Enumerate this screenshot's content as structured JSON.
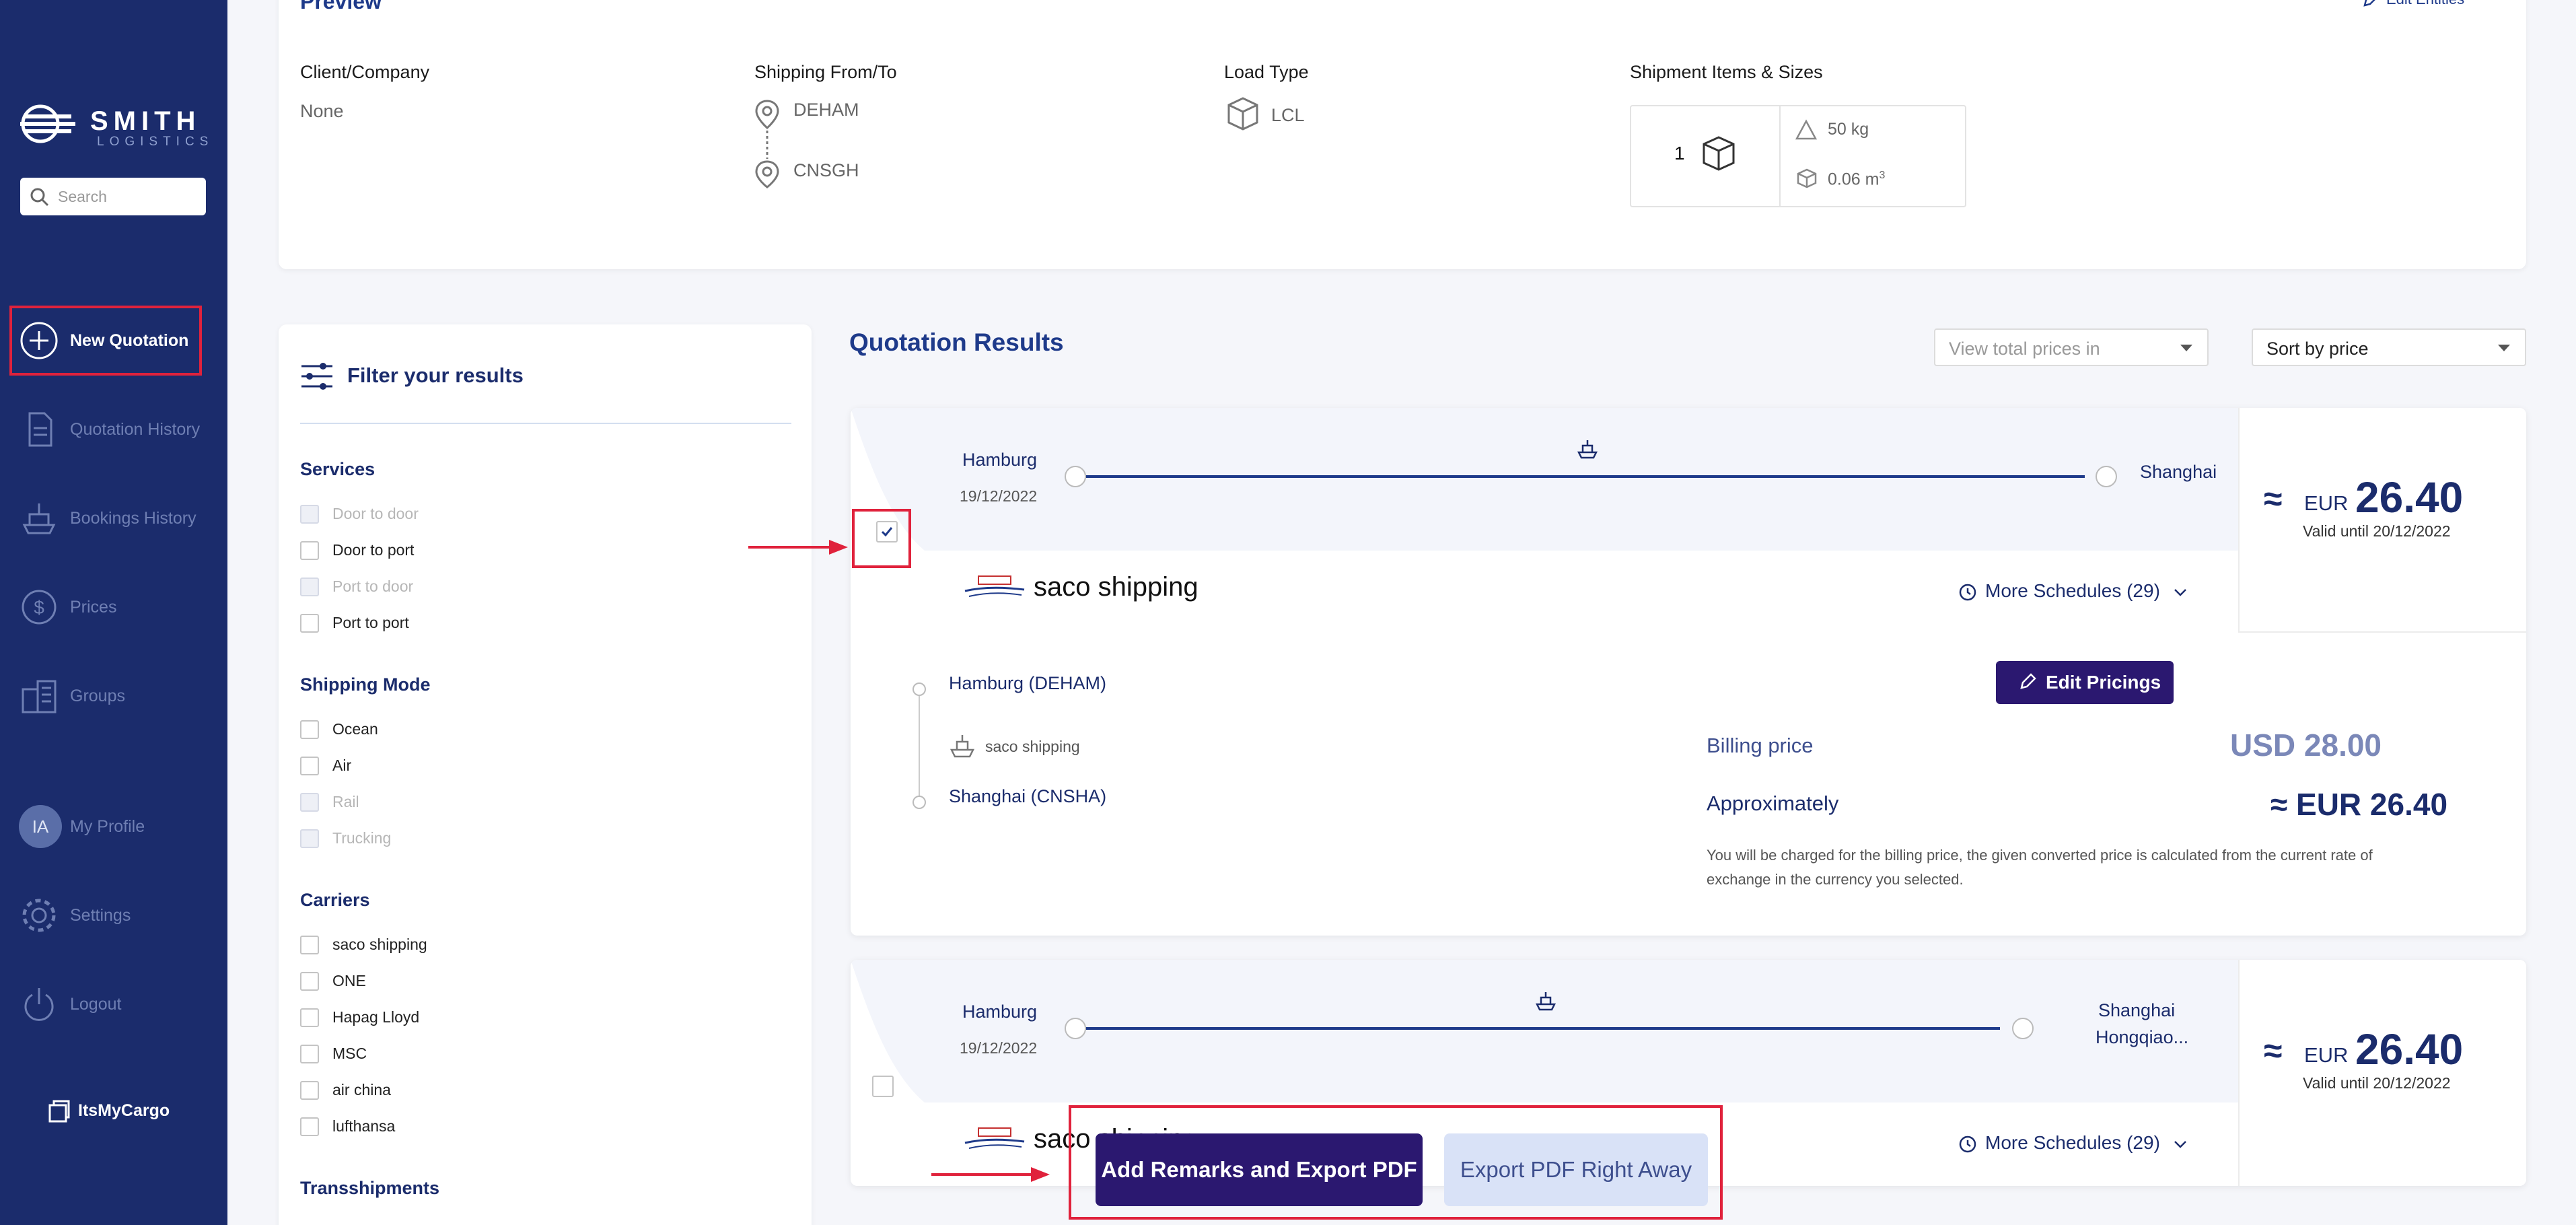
{
  "sidebar": {
    "logo_word": "SMITH",
    "logo_sub": "LOGISTICS",
    "search_placeholder": "Search",
    "items": [
      {
        "label": "New Quotation"
      },
      {
        "label": "Quotation History"
      },
      {
        "label": "Bookings History"
      },
      {
        "label": "Prices"
      },
      {
        "label": "Groups"
      },
      {
        "label": "My Profile",
        "initials": "IA"
      },
      {
        "label": "Settings"
      },
      {
        "label": "Logout"
      }
    ],
    "footer_brand": "ItsMyCargo"
  },
  "preview": {
    "title": "Preview",
    "edit_link": "Edit Entities",
    "client_label": "Client/Company",
    "client_value": "None",
    "shipping_label": "Shipping From/To",
    "from": "DEHAM",
    "to": "CNSGH",
    "load_label": "Load Type",
    "load_value": "LCL",
    "items_label": "Shipment Items & Sizes",
    "item_count": "1",
    "weight": "50 kg",
    "volume": "0.06 m",
    "volume_sup": "3"
  },
  "filters": {
    "title": "Filter your results",
    "services": {
      "title": "Services",
      "options": [
        {
          "label": "Door to door",
          "disabled": true
        },
        {
          "label": "Door to port",
          "disabled": false
        },
        {
          "label": "Port to door",
          "disabled": true
        },
        {
          "label": "Port to port",
          "disabled": false
        }
      ]
    },
    "shipping_mode": {
      "title": "Shipping Mode",
      "options": [
        {
          "label": "Ocean",
          "disabled": false
        },
        {
          "label": "Air",
          "disabled": false
        },
        {
          "label": "Rail",
          "disabled": true
        },
        {
          "label": "Trucking",
          "disabled": true
        }
      ]
    },
    "carriers": {
      "title": "Carriers",
      "options": [
        {
          "label": "saco shipping"
        },
        {
          "label": "ONE"
        },
        {
          "label": "Hapag Lloyd"
        },
        {
          "label": "MSC"
        },
        {
          "label": "air china"
        },
        {
          "label": "lufthansa"
        }
      ]
    },
    "transshipments": {
      "title": "Transshipments"
    }
  },
  "results": {
    "title": "Quotation Results",
    "view_prices_placeholder": "View total prices in",
    "sort_value": "Sort by price",
    "cards": [
      {
        "origin": "Hamburg",
        "date": "19/12/2022",
        "destination": "Shanghai",
        "destination_line2": "",
        "approx": "≈",
        "currency": "EUR",
        "amount": "26.40",
        "valid": "Valid until 20/12/2022",
        "carrier": "saco shipping",
        "more_schedules": "More Schedules (29)",
        "checked": true
      },
      {
        "origin": "Hamburg",
        "date": "19/12/2022",
        "destination": "Shanghai",
        "destination_line2": "Hongqiao...",
        "approx": "≈",
        "currency": "EUR",
        "amount": "26.40",
        "valid": "Valid until 20/12/2022",
        "carrier": "saco shipping",
        "more_schedules": "More Schedules (29)",
        "checked": false
      }
    ],
    "detail": {
      "origin_port": "Hamburg (DEHAM)",
      "carrier": "saco shipping",
      "destination_port": "Shanghai (CNSHA)",
      "edit_button": "Edit Pricings",
      "billing_label": "Billing price",
      "billing_value": "USD 28.00",
      "approx_label": "Approximately",
      "approx_value": "≈ EUR 26.40",
      "note_line1": "You will be charged for the billing price, the given converted price is calculated from the current rate of",
      "note_line2": "exchange in the currency you selected."
    }
  },
  "actions": {
    "add_remarks": "Add Remarks and Export PDF",
    "export_pdf": "Export PDF Right Away"
  },
  "colors": {
    "sidebar": "#1b2c6c",
    "primary_button": "#2b1870",
    "highlight": "#e0223c",
    "secondary_button": "#d9e2f7"
  }
}
